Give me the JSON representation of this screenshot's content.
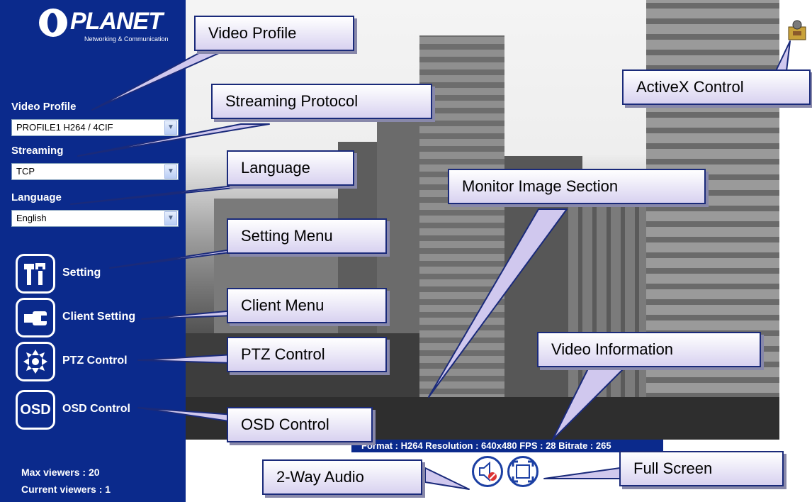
{
  "logo": {
    "brand": "PLANET",
    "tagline": "Networking & Communication"
  },
  "sidebar": {
    "video_profile": {
      "label": "Video Profile",
      "value": "PROFILE1 H264 / 4CIF"
    },
    "streaming": {
      "label": "Streaming",
      "value": "TCP"
    },
    "language": {
      "label": "Language",
      "value": "English"
    },
    "menu": [
      {
        "label": "Setting",
        "icon": "setting-tools-icon"
      },
      {
        "label": "Client Setting",
        "icon": "wrench-icon"
      },
      {
        "label": "PTZ Control",
        "icon": "ptz-arrows-icon"
      },
      {
        "label": "OSD Control",
        "icon": "osd-icon",
        "icon_text": "OSD"
      }
    ],
    "max_viewers": "Max viewers : 20",
    "current_viewers": "Current viewers : 1"
  },
  "video_info": "Format : H264   Resolution : 640x480   FPS : 28   Bitrate : 265",
  "buttons": {
    "audio": "speaker-mute-icon",
    "fullscreen": "fullscreen-icon",
    "activex": "activex-icon"
  },
  "callouts": {
    "video_profile": "Video Profile",
    "streaming_protocol": "Streaming Protocol",
    "language": "Language",
    "setting_menu": "Setting Menu",
    "client_menu": "Client Menu",
    "ptz_control": "PTZ Control",
    "osd_control": "OSD Control",
    "monitor_image": "Monitor Image Section",
    "video_information": "Video Information",
    "activex_control": "ActiveX Control",
    "two_way_audio": "2-Way Audio",
    "full_screen": "Full Screen"
  },
  "colors": {
    "sidebar": "#0b2a8c",
    "callout_border": "#1a2a7a",
    "callout_fill": "#d8d2f0"
  }
}
